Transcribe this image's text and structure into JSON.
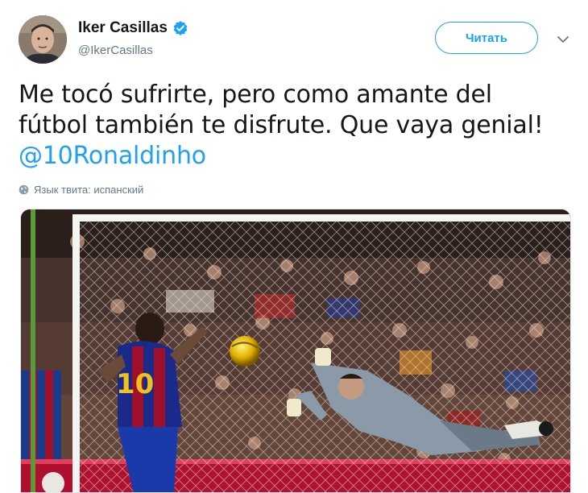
{
  "author": {
    "name": "Iker Casillas",
    "handle": "@IkerCasillas",
    "verified_icon": "verified-badge-icon"
  },
  "follow_button": {
    "label": "Читать"
  },
  "menu": {
    "icon": "chevron-down-icon"
  },
  "tweet": {
    "text_line1": "Me tocó sufrirte, pero como amante del",
    "text_line2": "fútbol también te disfrute. Que vaya genial!",
    "mention": "@10Ronaldinho"
  },
  "language": {
    "icon": "globe-icon",
    "label": "Язык твита: испанский"
  },
  "media": {
    "description_icon": "photo-football-goal",
    "jersey_number": "10"
  },
  "colors": {
    "accent": "#1da1f2",
    "text": "#14171a",
    "secondary": "#657786"
  }
}
